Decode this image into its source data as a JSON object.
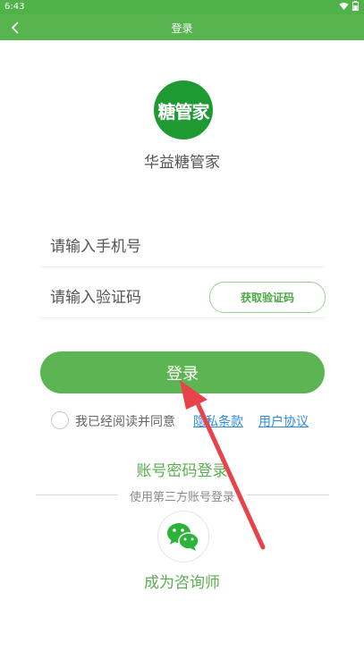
{
  "status_bar": {
    "time": "6:43"
  },
  "app_bar": {
    "title": "登录"
  },
  "logo": {
    "text": "糖管家"
  },
  "app_name": "华益糖管家",
  "phone_field": {
    "placeholder": "请输入手机号",
    "value": ""
  },
  "code_field": {
    "placeholder": "请输入验证码",
    "value": ""
  },
  "get_code_label": "获取验证码",
  "login_label": "登录",
  "agreement": {
    "text": "我已经阅读并同意",
    "privacy_label": "隐私条款",
    "user_label": "用户协议",
    "checked": false
  },
  "password_login_label": "账号密码登录",
  "third_party_label": "使用第三方账号登录",
  "wechat_icon": "wechat-icon",
  "consultant_label": "成为咨询师",
  "colors": {
    "primary": "#5cb552",
    "status_bar": "#4fb34a",
    "link": "#2f8be0",
    "annotation_arrow": "#e8424a"
  }
}
